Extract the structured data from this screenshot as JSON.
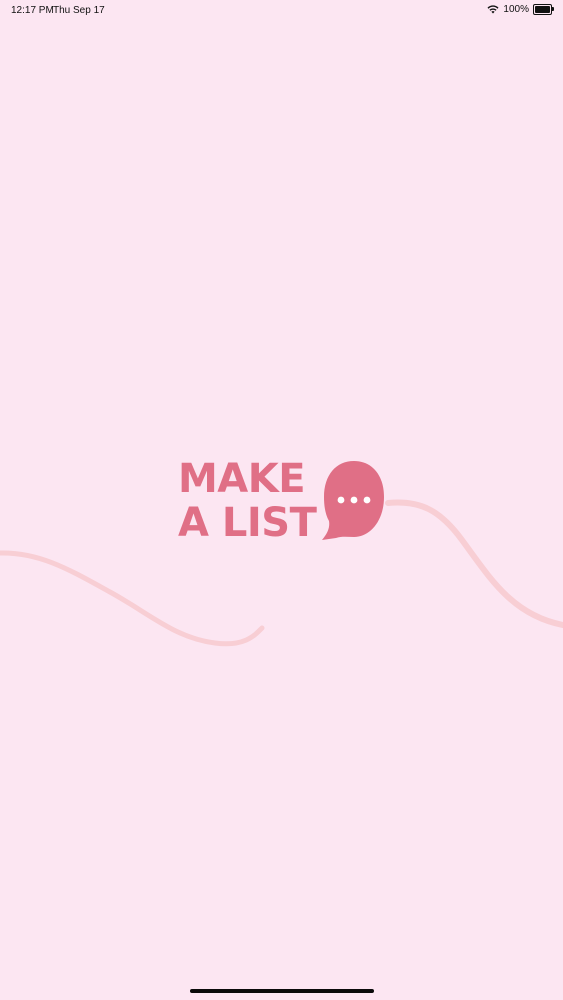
{
  "status_bar": {
    "time": "12:17 PM",
    "date": "Thu Sep 17",
    "battery": "100%",
    "battery_level": 1.0
  },
  "logo": {
    "line1": "MAKE",
    "line2": "A LIST",
    "icon": "speech-bubble-ellipsis-icon"
  },
  "colors": {
    "background": "#fce6f2",
    "brand": "#e06f86",
    "wave": "#f7c9cf"
  }
}
